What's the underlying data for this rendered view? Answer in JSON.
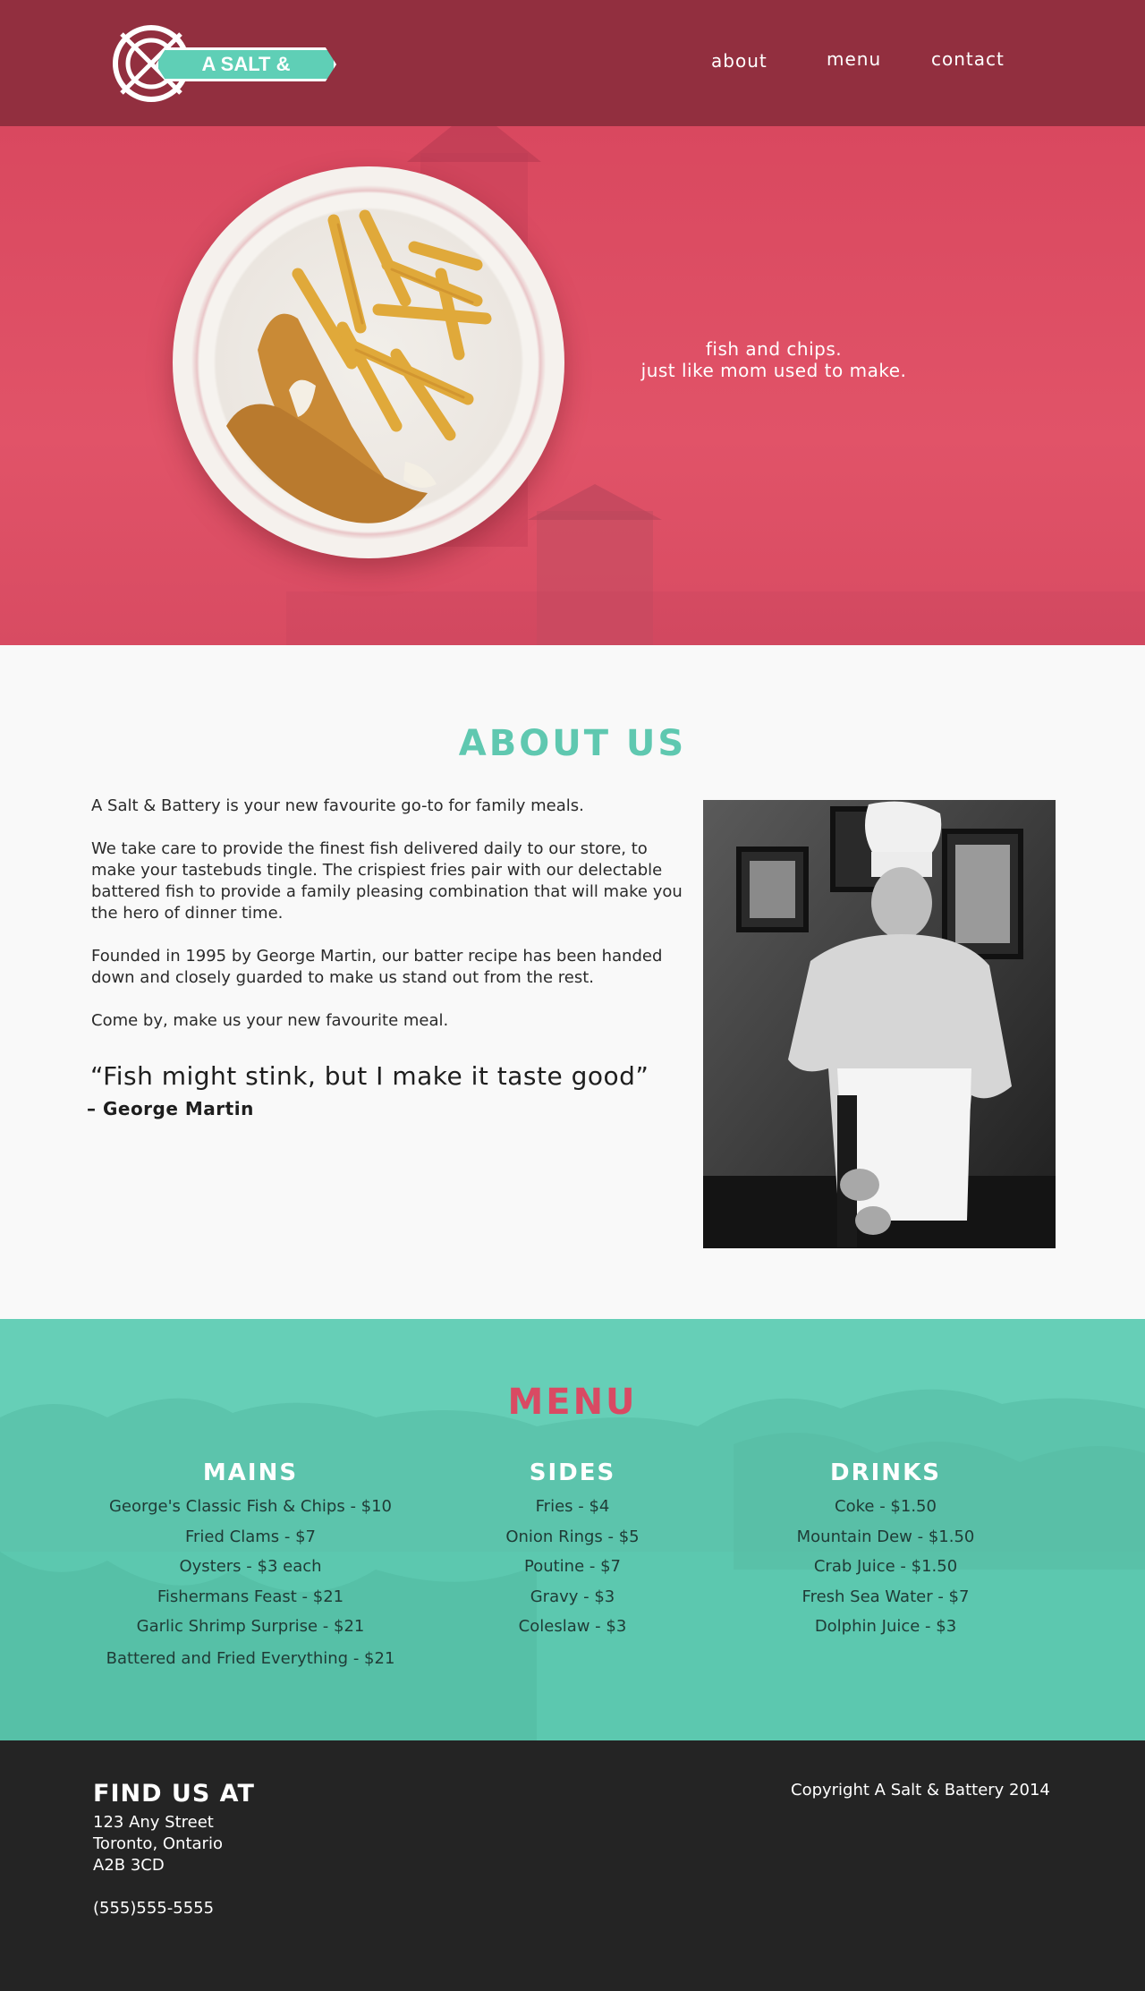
{
  "header": {
    "logo_text": "A SALT & BATTERY",
    "nav": [
      {
        "label": "about"
      },
      {
        "label": "menu"
      },
      {
        "label": "contact"
      }
    ]
  },
  "hero": {
    "tagline_line1": "fish and chips.",
    "tagline_line2": "just like mom used to make."
  },
  "about": {
    "title": "ABOUT US",
    "paragraphs": [
      "A Salt & Battery is your new favourite go-to for family meals.",
      "We take care to provide the finest fish delivered daily to our store, to make your tastebuds tingle. The crispiest fries pair with our delectable battered fish to provide a family pleasing combination that will make you the hero of dinner time.",
      "Founded in 1995 by George Martin, our batter recipe has been handed down and closely guarded to make us stand out from the rest.",
      "Come by, make us your new favourite meal."
    ],
    "quote": "“Fish might stink, but I make it taste good”",
    "quote_author": "– George Martin"
  },
  "menu": {
    "title": "MENU",
    "columns": [
      {
        "heading": "MAINS",
        "items": [
          "George's Classic Fish & Chips - $10",
          "Fried Clams - $7",
          "Oysters - $3 each",
          "Fishermans Feast - $21",
          "Garlic Shrimp Surprise - $21",
          "Battered and Fried Everything - $21"
        ]
      },
      {
        "heading": "SIDES",
        "items": [
          "Fries - $4",
          "Onion Rings - $5",
          "Poutine - $7",
          "Gravy - $3",
          "Coleslaw - $3"
        ]
      },
      {
        "heading": "DRINKS",
        "items": [
          "Coke - $1.50",
          "Mountain Dew - $1.50",
          "Crab Juice - $1.50",
          "Fresh Sea Water - $7",
          "Dolphin Juice - $3"
        ]
      }
    ]
  },
  "footer": {
    "find_title": "FIND US AT",
    "address_line1": "123 Any Street",
    "address_line2": "Toronto, Ontario",
    "address_line3": "A2B 3CD",
    "phone": "(555)555-5555",
    "copyright": "Copyright A Salt & Battery 2014"
  },
  "colors": {
    "header_bg": "#922f3f",
    "hero_bg": "#d94a63",
    "teal_accent": "#5fc8b0",
    "menu_bg": "#62cdb5",
    "footer_bg": "#242424"
  }
}
